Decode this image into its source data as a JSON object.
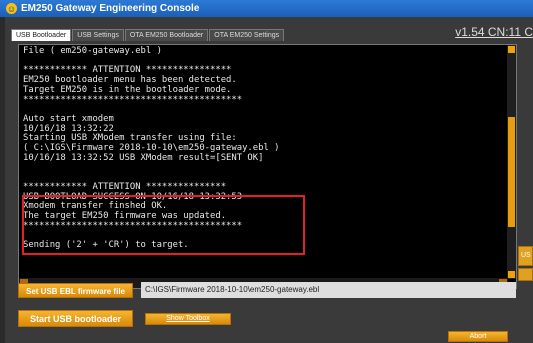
{
  "window": {
    "title": "EM250 Gateway Engineering Console"
  },
  "tabs": [
    {
      "label": "USB Bootloader"
    },
    {
      "label": "USB Settings"
    },
    {
      "label": "OTA EM250 Bootloader"
    },
    {
      "label": "OTA EM250 Settings"
    }
  ],
  "version": "v1.54  CN:11  C",
  "console": {
    "lines": [
      "File ( em250-gateway.ebl )",
      "",
      "************ ATTENTION ****************",
      "EM250 bootloader menu has been detected.",
      "Target EM250 is in the bootloader mode.",
      "*****************************************",
      "",
      "Auto start xmodem",
      "10/16/18 13:32:22",
      "Starting USB XModem transfer using file:",
      "( C:\\IGS\\Firmware 2018-10-10\\em250-gateway.ebl )",
      "10/16/18 13:32:52 USB XModem result=[SENT OK]",
      "",
      "",
      "************ ATTENTION ***************",
      "USB BOOTLOAD SUCCESS ON 10/16/18 13:32:53",
      "Xmodem transfer finshed OK.",
      "The target EM250 firmware was updated.",
      "*****************************************",
      "",
      "Sending ('2' + 'CR') to target."
    ]
  },
  "buttons": {
    "set_firmware": "Set USB EBL firmware file",
    "start_bootloader": "Start USB bootloader",
    "show_toolbox": "Show Toolbox",
    "abort": "Abort",
    "side_label": "US"
  },
  "firmware_path": "C:\\IGS\\Firmware 2018-10-10\\em250-gateway.ebl"
}
